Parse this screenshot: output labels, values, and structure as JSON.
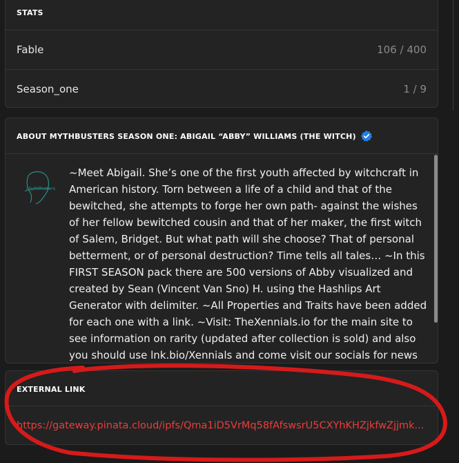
{
  "stats": {
    "header": "STATS",
    "rows": [
      {
        "name": "Fable",
        "value": "106 / 400"
      },
      {
        "name": "Season_one",
        "value": "1 / 9"
      }
    ]
  },
  "about": {
    "header": "ABOUT MYTHBUSTERS SEASON ONE: ABIGAIL “ABBY” WILLIAMS (THE WITCH)",
    "logo_text": "MythBusters",
    "description": "~Meet Abigail. She’s one of the first youth affected by witchcraft in American history. Torn between a life of a child and that of the bewitched, she attempts to forge her own path- against the wishes of her fellow bewitched cousin and that of her maker, the first witch of Salem, Bridget. But what path will she choose? That of personal betterment, or of personal destruction? Time tells all tales… ~In this FIRST SEASON pack there are 500 versions of Abby visualized and created by Sean (Vincent Van Sno) H. using the Hashlips Art Generator with delimiter. ~All Properties and Traits have been added for each one with a link. ~Visit: TheXennials.io for the main site to see information on rarity (updated after collection is sold) and also you should use lnk.bio/Xennials and come visit our socials for news and",
    "scrollbar_position": 0.0
  },
  "external": {
    "header": "EXTERNAL LINK",
    "url": "https://gateway.pinata.cloud/ipfs/Qma1iD5VrMq58fAfswsrU5CXYhKHZjkfwZjjmk..."
  },
  "colors": {
    "background": "#1b1b1b",
    "panel": "#232323",
    "border": "#353535",
    "link": "#ef3b3b",
    "verified": "#2081e2",
    "annotation": "#d61a1a"
  },
  "icons": {
    "verified": "verified-check-icon"
  }
}
